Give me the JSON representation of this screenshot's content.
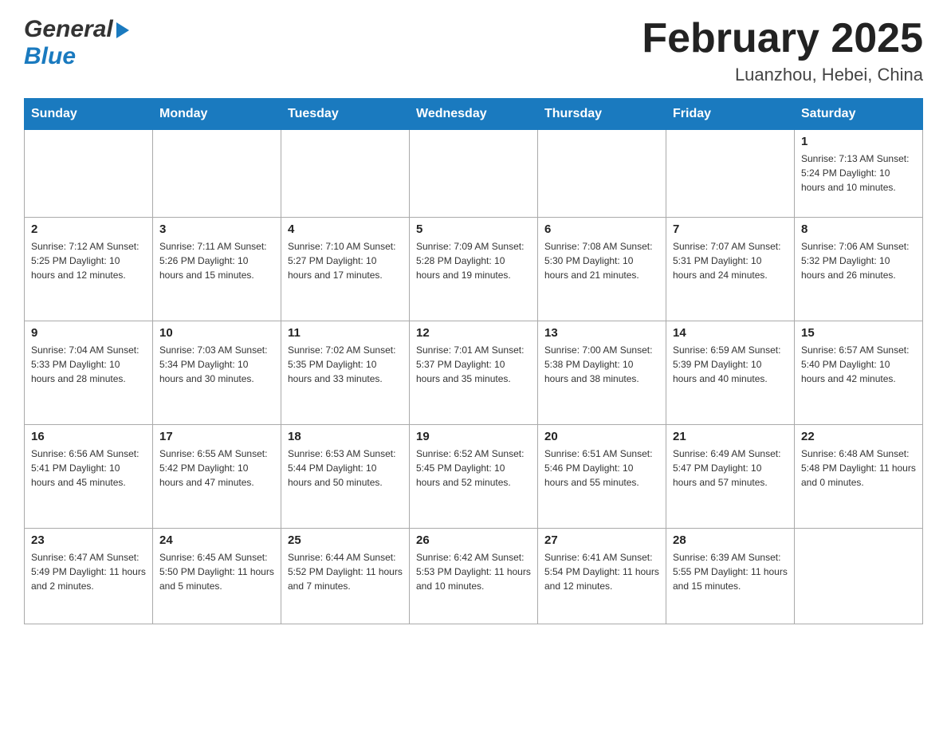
{
  "logo": {
    "general": "General",
    "blue": "Blue",
    "arrow": "▶"
  },
  "header": {
    "month": "February 2025",
    "location": "Luanzhou, Hebei, China"
  },
  "weekdays": [
    "Sunday",
    "Monday",
    "Tuesday",
    "Wednesday",
    "Thursday",
    "Friday",
    "Saturday"
  ],
  "weeks": [
    {
      "days": [
        {
          "number": "",
          "info": ""
        },
        {
          "number": "",
          "info": ""
        },
        {
          "number": "",
          "info": ""
        },
        {
          "number": "",
          "info": ""
        },
        {
          "number": "",
          "info": ""
        },
        {
          "number": "",
          "info": ""
        },
        {
          "number": "1",
          "info": "Sunrise: 7:13 AM\nSunset: 5:24 PM\nDaylight: 10 hours\nand 10 minutes."
        }
      ]
    },
    {
      "days": [
        {
          "number": "2",
          "info": "Sunrise: 7:12 AM\nSunset: 5:25 PM\nDaylight: 10 hours\nand 12 minutes."
        },
        {
          "number": "3",
          "info": "Sunrise: 7:11 AM\nSunset: 5:26 PM\nDaylight: 10 hours\nand 15 minutes."
        },
        {
          "number": "4",
          "info": "Sunrise: 7:10 AM\nSunset: 5:27 PM\nDaylight: 10 hours\nand 17 minutes."
        },
        {
          "number": "5",
          "info": "Sunrise: 7:09 AM\nSunset: 5:28 PM\nDaylight: 10 hours\nand 19 minutes."
        },
        {
          "number": "6",
          "info": "Sunrise: 7:08 AM\nSunset: 5:30 PM\nDaylight: 10 hours\nand 21 minutes."
        },
        {
          "number": "7",
          "info": "Sunrise: 7:07 AM\nSunset: 5:31 PM\nDaylight: 10 hours\nand 24 minutes."
        },
        {
          "number": "8",
          "info": "Sunrise: 7:06 AM\nSunset: 5:32 PM\nDaylight: 10 hours\nand 26 minutes."
        }
      ]
    },
    {
      "days": [
        {
          "number": "9",
          "info": "Sunrise: 7:04 AM\nSunset: 5:33 PM\nDaylight: 10 hours\nand 28 minutes."
        },
        {
          "number": "10",
          "info": "Sunrise: 7:03 AM\nSunset: 5:34 PM\nDaylight: 10 hours\nand 30 minutes."
        },
        {
          "number": "11",
          "info": "Sunrise: 7:02 AM\nSunset: 5:35 PM\nDaylight: 10 hours\nand 33 minutes."
        },
        {
          "number": "12",
          "info": "Sunrise: 7:01 AM\nSunset: 5:37 PM\nDaylight: 10 hours\nand 35 minutes."
        },
        {
          "number": "13",
          "info": "Sunrise: 7:00 AM\nSunset: 5:38 PM\nDaylight: 10 hours\nand 38 minutes."
        },
        {
          "number": "14",
          "info": "Sunrise: 6:59 AM\nSunset: 5:39 PM\nDaylight: 10 hours\nand 40 minutes."
        },
        {
          "number": "15",
          "info": "Sunrise: 6:57 AM\nSunset: 5:40 PM\nDaylight: 10 hours\nand 42 minutes."
        }
      ]
    },
    {
      "days": [
        {
          "number": "16",
          "info": "Sunrise: 6:56 AM\nSunset: 5:41 PM\nDaylight: 10 hours\nand 45 minutes."
        },
        {
          "number": "17",
          "info": "Sunrise: 6:55 AM\nSunset: 5:42 PM\nDaylight: 10 hours\nand 47 minutes."
        },
        {
          "number": "18",
          "info": "Sunrise: 6:53 AM\nSunset: 5:44 PM\nDaylight: 10 hours\nand 50 minutes."
        },
        {
          "number": "19",
          "info": "Sunrise: 6:52 AM\nSunset: 5:45 PM\nDaylight: 10 hours\nand 52 minutes."
        },
        {
          "number": "20",
          "info": "Sunrise: 6:51 AM\nSunset: 5:46 PM\nDaylight: 10 hours\nand 55 minutes."
        },
        {
          "number": "21",
          "info": "Sunrise: 6:49 AM\nSunset: 5:47 PM\nDaylight: 10 hours\nand 57 minutes."
        },
        {
          "number": "22",
          "info": "Sunrise: 6:48 AM\nSunset: 5:48 PM\nDaylight: 11 hours\nand 0 minutes."
        }
      ]
    },
    {
      "days": [
        {
          "number": "23",
          "info": "Sunrise: 6:47 AM\nSunset: 5:49 PM\nDaylight: 11 hours\nand 2 minutes."
        },
        {
          "number": "24",
          "info": "Sunrise: 6:45 AM\nSunset: 5:50 PM\nDaylight: 11 hours\nand 5 minutes."
        },
        {
          "number": "25",
          "info": "Sunrise: 6:44 AM\nSunset: 5:52 PM\nDaylight: 11 hours\nand 7 minutes."
        },
        {
          "number": "26",
          "info": "Sunrise: 6:42 AM\nSunset: 5:53 PM\nDaylight: 11 hours\nand 10 minutes."
        },
        {
          "number": "27",
          "info": "Sunrise: 6:41 AM\nSunset: 5:54 PM\nDaylight: 11 hours\nand 12 minutes."
        },
        {
          "number": "28",
          "info": "Sunrise: 6:39 AM\nSunset: 5:55 PM\nDaylight: 11 hours\nand 15 minutes."
        },
        {
          "number": "",
          "info": ""
        }
      ]
    }
  ]
}
